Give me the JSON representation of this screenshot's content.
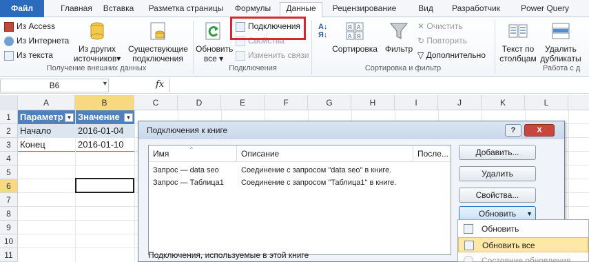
{
  "tabs": {
    "file": "Файл",
    "home": "Главная",
    "insert": "Вставка",
    "layout": "Разметка страницы",
    "formulas": "Формулы",
    "data": "Данные",
    "review": "Рецензирование",
    "view": "Вид",
    "developer": "Разработчик",
    "powerquery": "Power Query"
  },
  "ribbon": {
    "from_access": "Из Access",
    "from_web": "Из Интернета",
    "from_text": "Из текста",
    "from_other_1": "Из других",
    "from_other_2": "источников",
    "existing_1": "Существующие",
    "existing_2": "подключения",
    "group_get": "Получение внешних данных",
    "refresh_1": "Обновить",
    "refresh_2": "все",
    "connections": "Подключения",
    "properties": "Свойства",
    "edit_links": "Изменить связи",
    "group_conn": "Подключения",
    "sort": "Сортировка",
    "filter": "Фильтр",
    "clear": "Очистить",
    "reapply": "Повторить",
    "advanced": "Дополнительно",
    "group_sort": "Сортировка и фильтр",
    "text_cols_1": "Текст по",
    "text_cols_2": "столбцам",
    "remove_dup_1": "Удалить",
    "remove_dup_2": "дубликаты",
    "group_tools": "Работа с д"
  },
  "formula_bar": {
    "name_box": "B6",
    "fx": "fx",
    "formula": ""
  },
  "grid": {
    "columns": [
      "A",
      "B",
      "C",
      "D",
      "E",
      "F",
      "G",
      "H",
      "I",
      "J",
      "K",
      "L"
    ],
    "rows": [
      "1",
      "2",
      "3",
      "4",
      "5",
      "6",
      "7",
      "8",
      "9",
      "10",
      "11"
    ],
    "cells": {
      "A1": "Параметр",
      "B1": "Значение",
      "A2": "Начало",
      "B2": "2016-01-04",
      "A3": "Конец",
      "B3": "2016-01-10"
    }
  },
  "dialog": {
    "title": "Подключения к книге",
    "help": "?",
    "close": "X",
    "headers": {
      "name": "Имя",
      "description": "Описание",
      "last": "После..."
    },
    "rows": [
      {
        "name": "Запрос — data seo",
        "description": "Соединение с запросом \"data seo\" в книге."
      },
      {
        "name": "Запрос — Таблица1",
        "description": "Соединение с запросом \"Таблица1\" в книге."
      }
    ],
    "add": "Добавить...",
    "delete": "Удалить",
    "properties": "Свойства...",
    "refresh": "Обновить",
    "footer": "Подключения, используемые в этой книге",
    "menu": {
      "refresh": "Обновить",
      "refresh_all": "Обновить все",
      "status": "Состояние обновления"
    }
  },
  "colors": {
    "file_tab": "#2a6bbd",
    "table_header": "#4f81bd",
    "highlight": "#d6262e",
    "selected_header": "#f8d981"
  }
}
